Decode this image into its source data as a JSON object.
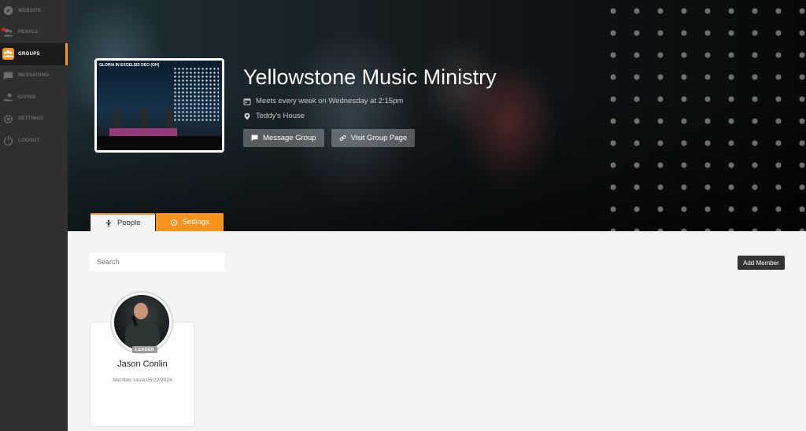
{
  "sidebar": {
    "items": [
      {
        "label": "WEBSITE",
        "icon": "compass-icon"
      },
      {
        "label": "PEOPLE",
        "icon": "people-icon"
      },
      {
        "label": "GROUPS",
        "icon": "groups-icon",
        "active": true
      },
      {
        "label": "MESSAGING",
        "icon": "chat-icon"
      },
      {
        "label": "GIVING",
        "icon": "giving-icon"
      },
      {
        "label": "SETTINGS",
        "icon": "gear-icon"
      },
      {
        "label": "LOGOUT",
        "icon": "power-icon"
      }
    ],
    "accent": "#f7941d"
  },
  "hero": {
    "thumbnail_caption": "GLORIA IN EXCELSIS DEO (OH)",
    "title": "Yellowstone Music Ministry",
    "schedule": "Meets every week on Wednesday at 2:15pm",
    "location": "Teddy's House",
    "message_button": "Message Group",
    "visit_button": "Visit Group Page"
  },
  "tabs": {
    "people": "People",
    "settings": "Settings"
  },
  "main": {
    "search_placeholder": "Search",
    "add_member": "Add Member"
  },
  "members": [
    {
      "name": "Jason Conlin",
      "role": "LEADER",
      "since": "Member since 05/22/2024"
    }
  ]
}
